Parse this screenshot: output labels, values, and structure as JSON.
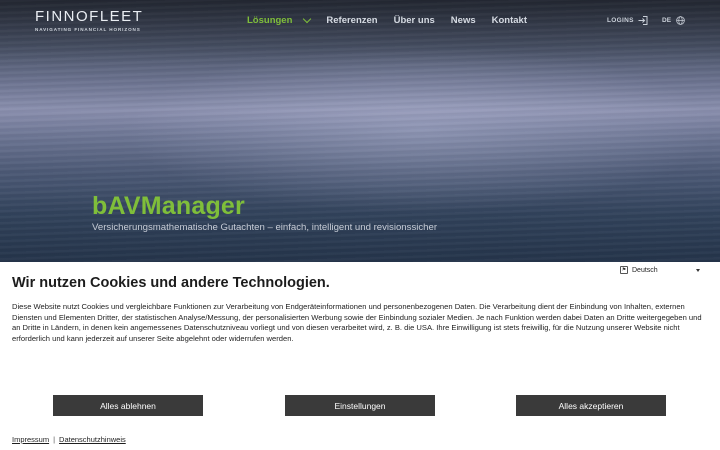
{
  "header": {
    "logo_text": "FINNOFLEET",
    "logo_tagline": "NAVIGATING FINANCIAL HORIZONS",
    "nav": [
      {
        "label": "Lösungen",
        "active": true
      },
      {
        "label": "Referenzen",
        "active": false
      },
      {
        "label": "Über uns",
        "active": false
      },
      {
        "label": "News",
        "active": false
      },
      {
        "label": "Kontakt",
        "active": false
      }
    ],
    "login_label": "LOGINS",
    "language_label": "DE"
  },
  "hero": {
    "title": "bAVManager",
    "subtitle": "Versicherungsmathematische Gutachten – einfach, intelligent und revisionssicher"
  },
  "cookie_banner": {
    "title": "Wir nutzen Cookies und andere Technologien.",
    "language_select": "Deutsch",
    "text": "Diese Website nutzt Cookies und vergleichbare Funktionen zur Verarbeitung von Endgeräteinformationen und personenbezogenen Daten. Die Verarbeitung dient der Einbindung von Inhalten, externen Diensten und Elementen Dritter, der statistischen Analyse/Messung, der personalisierten Werbung sowie der Einbindung sozialer Medien. Je nach Funktion werden dabei Daten an Dritte weitergegeben und an Dritte in Ländern, in denen kein angemessenes Datenschutzniveau vorliegt und von diesen verarbeitet wird, z. B. die USA. Ihre Einwilligung ist stets freiwillig, für die Nutzung unserer Website nicht erforderlich und kann jederzeit auf unserer Seite abgelehnt oder widerrufen werden.",
    "buttons": {
      "reject": "Alles ablehnen",
      "settings": "Einstellungen",
      "accept": "Alles akzeptieren"
    },
    "links": {
      "imprint": "Impressum",
      "privacy": "Datenschutzhinweis"
    }
  },
  "colors": {
    "accent_green": "#7fbe3a",
    "button_dark": "#3a3a3a"
  }
}
